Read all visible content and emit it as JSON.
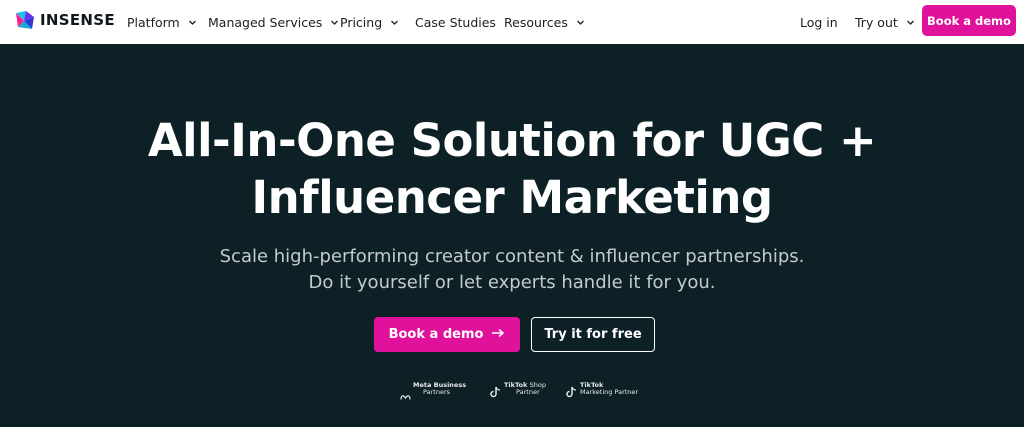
{
  "nav": {
    "logo_text": "INSENSE",
    "items": [
      {
        "label": "Platform",
        "has_dropdown": true
      },
      {
        "label": "Managed Services",
        "has_dropdown": true
      },
      {
        "label": "Pricing",
        "has_dropdown": true
      },
      {
        "label": "Case Studies",
        "has_dropdown": false
      },
      {
        "label": "Resources",
        "has_dropdown": true
      }
    ],
    "login": "Log in",
    "try_out": "Try out",
    "book_demo": "Book a demo"
  },
  "hero": {
    "headline_line1": "All-In-One Solution for UGC +",
    "headline_line2": "Influencer Marketing",
    "subtitle_line1": "Scale high-performing creator content & influencer partnerships.",
    "subtitle_line2": "Do it yourself or let experts handle it for you.",
    "primary_cta": "Book a demo",
    "secondary_cta": "Try it for free"
  },
  "partners": [
    {
      "icon": "meta-icon",
      "line1": "Meta Business",
      "line2": "Partners"
    },
    {
      "icon": "tiktok-icon",
      "line1": "TikTok",
      "line1_suffix": "Shop",
      "line2": "Partner"
    },
    {
      "icon": "tiktok-icon",
      "line1": "TikTok",
      "line2": "Marketing Partner"
    }
  ],
  "colors": {
    "accent": "#e0119a",
    "hero_bg": "#0c2026",
    "nav_bg": "#ffffff"
  }
}
